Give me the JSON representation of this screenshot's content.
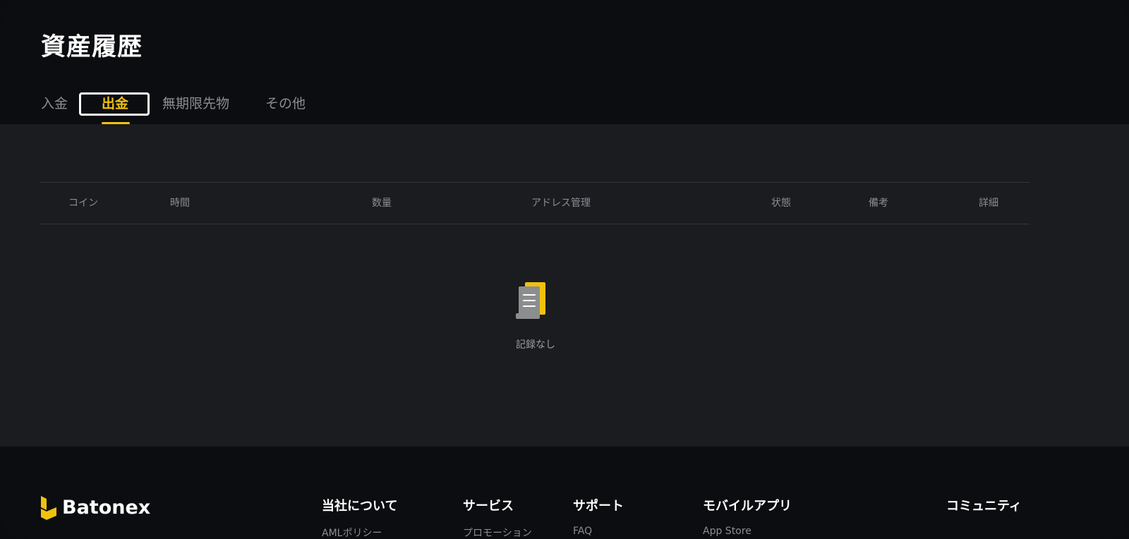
{
  "page": {
    "title": "資産履歴"
  },
  "tabs": [
    {
      "label": "入金",
      "active": false
    },
    {
      "label": "出金",
      "active": true
    },
    {
      "label": "無期限先物",
      "active": false
    },
    {
      "label": "その他",
      "active": false
    }
  ],
  "table": {
    "columns": [
      "コイン",
      "時間",
      "数量",
      "アドレス管理",
      "状態",
      "備考",
      "詳細"
    ]
  },
  "empty_state": {
    "message": "記録なし",
    "icon": "empty-document-icon"
  },
  "footer": {
    "brand": "Batonex",
    "columns": [
      {
        "title": "当社について",
        "first_link": "AMLポリシー"
      },
      {
        "title": "サービス",
        "first_link": "プロモーション"
      },
      {
        "title": "サポート",
        "first_link": "FAQ"
      },
      {
        "title": "モバイルアプリ",
        "first_link": "App Store"
      },
      {
        "title": "コミュニティ",
        "first_link": ""
      }
    ]
  },
  "colors": {
    "accent": "#f0c20c",
    "background": "#0c0d10",
    "panel": "#1b1c20"
  }
}
